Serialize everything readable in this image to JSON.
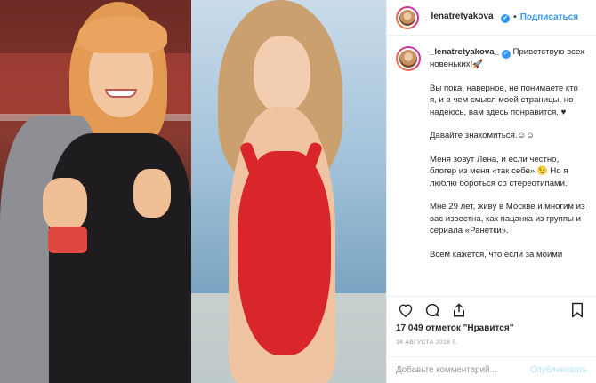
{
  "post": {
    "username": "_lenatretyakova_",
    "follow_label": "Подписаться",
    "separator": "•",
    "more_label": "•••"
  },
  "caption": {
    "username": "_lenatretyakova_",
    "first_line": "Приветствую всех новеньких!🚀",
    "paragraphs": [
      "Вы пока, наверное, не понимаете кто я, и в чем смысл моей страницы, но надеюсь, вам здесь понравится. ♥",
      "Давайте знакомиться.☺☺",
      "Меня зовут Лена, и если честно, блогер из меня «так себе».😉 Но я люблю бороться со стереотипами.",
      "Мне 29 лет, живу в Москве и многим из вас известна, как пацанка из группы и сериала «Ранетки».",
      "Всем кажется, что если за моими"
    ]
  },
  "stats": {
    "likes": "17 049 отметок \"Нравится\"",
    "date": "14 августа 2018 г."
  },
  "comment_box": {
    "placeholder": "Добавьте комментарий...",
    "publish_label": "Опубликовать"
  },
  "colors": {
    "link_blue": "#3897f0",
    "swimsuit_red": "#d8262a"
  }
}
